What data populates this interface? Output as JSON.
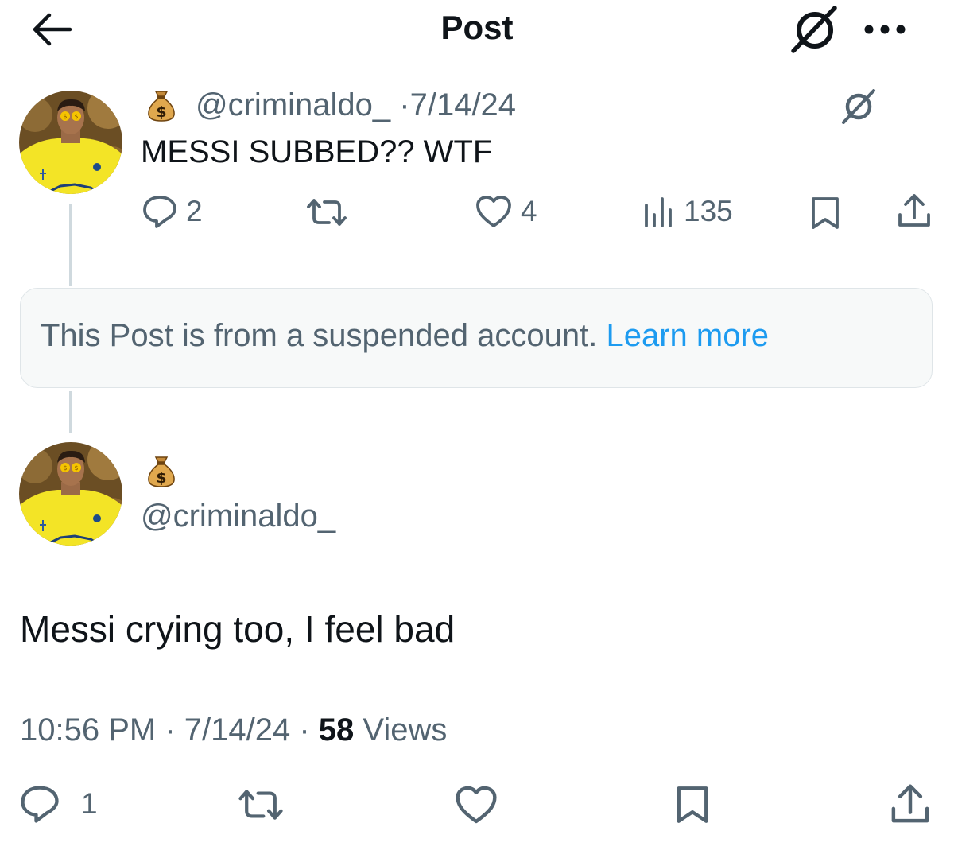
{
  "header": {
    "title": "Post",
    "back_icon": "arrow-left-icon",
    "grok_icon": "grok-slash-circle-icon",
    "more_icon": "more-dots-icon"
  },
  "tweet1": {
    "handle": "@criminaldo_",
    "separator": "·",
    "date": "7/14/24",
    "text": "MESSI SUBBED?? WTF",
    "stats": {
      "replies": "2",
      "likes": "4",
      "views": "135"
    }
  },
  "suspended": {
    "message": "This Post is from a suspended account. ",
    "link": "Learn more"
  },
  "tweet2": {
    "handle": "@criminaldo_",
    "text": "Messi crying too, I feel bad",
    "time": "10:56 PM",
    "sep1": " · ",
    "date": "7/14/24",
    "sep2": " · ",
    "views_count": "58",
    "views_label": " Views",
    "stats": {
      "replies": "1"
    }
  },
  "colors": {
    "text": "#0f1419",
    "secondary": "#536471",
    "link": "#1d9bf0",
    "card_bg": "#f7f9f9",
    "thread_line": "#cfd9de",
    "avatar_bg": "#7a5a2c",
    "jersey": "#f2e12a"
  }
}
